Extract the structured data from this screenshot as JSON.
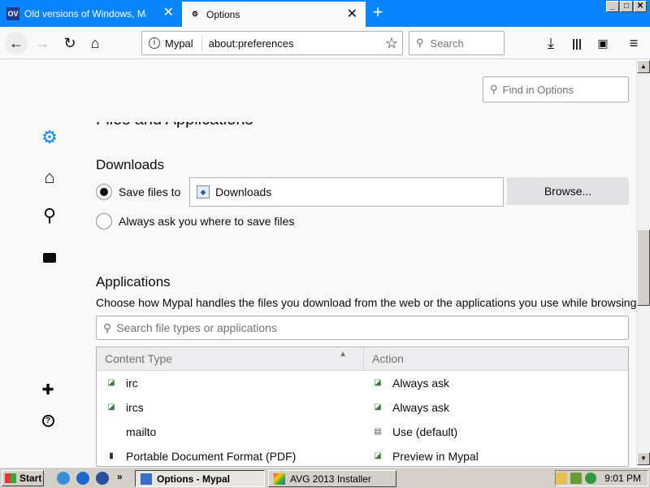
{
  "tabs": [
    {
      "favicon": "OV",
      "title": "Old versions of Windows, Mac and",
      "close": "✕"
    },
    {
      "favicon": "gear-icon",
      "title": "Options",
      "close": "✕"
    }
  ],
  "new_tab": "+",
  "window_controls": [
    "_",
    "□",
    "✕"
  ],
  "navbar": {
    "site_label": "Mypal",
    "url": "about:preferences",
    "search_placeholder": "Search"
  },
  "find_in_options_placeholder": "Find in Options",
  "section_title": "Files and Applications",
  "downloads": {
    "heading": "Downloads",
    "save_files_label": "Save files to",
    "save_folder": "Downloads",
    "browse_label": "Browse...",
    "always_ask_label": "Always ask you where to save files",
    "selected": "save"
  },
  "applications": {
    "heading": "Applications",
    "description": "Choose how Mypal handles the files you download from the web or the applications you use while browsing.",
    "search_placeholder": "Search file types or applications",
    "columns": [
      "Content Type",
      "Action"
    ],
    "rows": [
      {
        "type": "irc",
        "action": "Always ask"
      },
      {
        "type": "ircs",
        "action": "Always ask"
      },
      {
        "type": "mailto",
        "action": "Use  (default)"
      },
      {
        "type": "Portable Document Format (PDF)",
        "action": "Preview in Mypal"
      }
    ]
  },
  "taskbar": {
    "start_label": "Start",
    "tasks": [
      "Options - Mypal",
      "AVG 2013 Installer"
    ],
    "clock": "9:01 PM"
  }
}
